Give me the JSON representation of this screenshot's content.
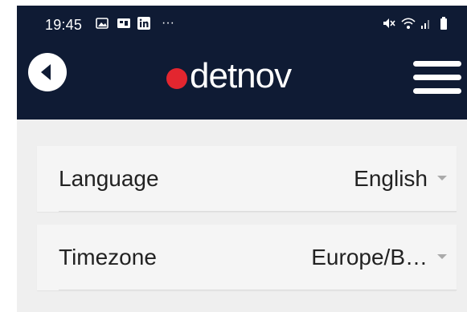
{
  "status_bar": {
    "time": "19:45",
    "dots": "···",
    "icons_left": [
      "gallery-icon",
      "sim-icon",
      "linkedin-icon"
    ],
    "icons_right": [
      "mute-icon",
      "wifi-icon",
      "signal-icon",
      "battery-icon"
    ]
  },
  "app_bar": {
    "logo_text": "detnov",
    "colors": {
      "background": "#0f1b34",
      "logo_dot": "#e3262f"
    }
  },
  "settings": {
    "language": {
      "label": "Language",
      "value": "English"
    },
    "timezone": {
      "label": "Timezone",
      "value": "Europe/B…"
    }
  }
}
